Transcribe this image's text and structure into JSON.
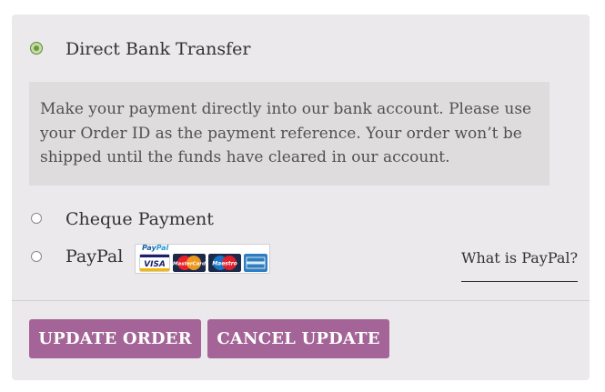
{
  "payment_methods": [
    {
      "label": "Direct Bank Transfer",
      "selected": true,
      "description": "Make your payment directly into our bank account. Please use your Order ID as the payment reference. Your order won’t be shipped until the funds have cleared in our account."
    },
    {
      "label": "Cheque Payment",
      "selected": false
    },
    {
      "label": "PayPal",
      "selected": false,
      "badge": {
        "brand_part1": "Pay",
        "brand_part2": "Pal",
        "cards": [
          "visa-icon",
          "mastercard-icon",
          "maestro-icon",
          "amex-icon"
        ]
      },
      "info_link": "What is PayPal?"
    }
  ],
  "buttons": {
    "update": "UPDATE ORDER",
    "cancel": "CANCEL UPDATE"
  },
  "colors": {
    "button": "#a46497",
    "panel": "#ebe9eb",
    "description_bg": "#dfdcde"
  }
}
